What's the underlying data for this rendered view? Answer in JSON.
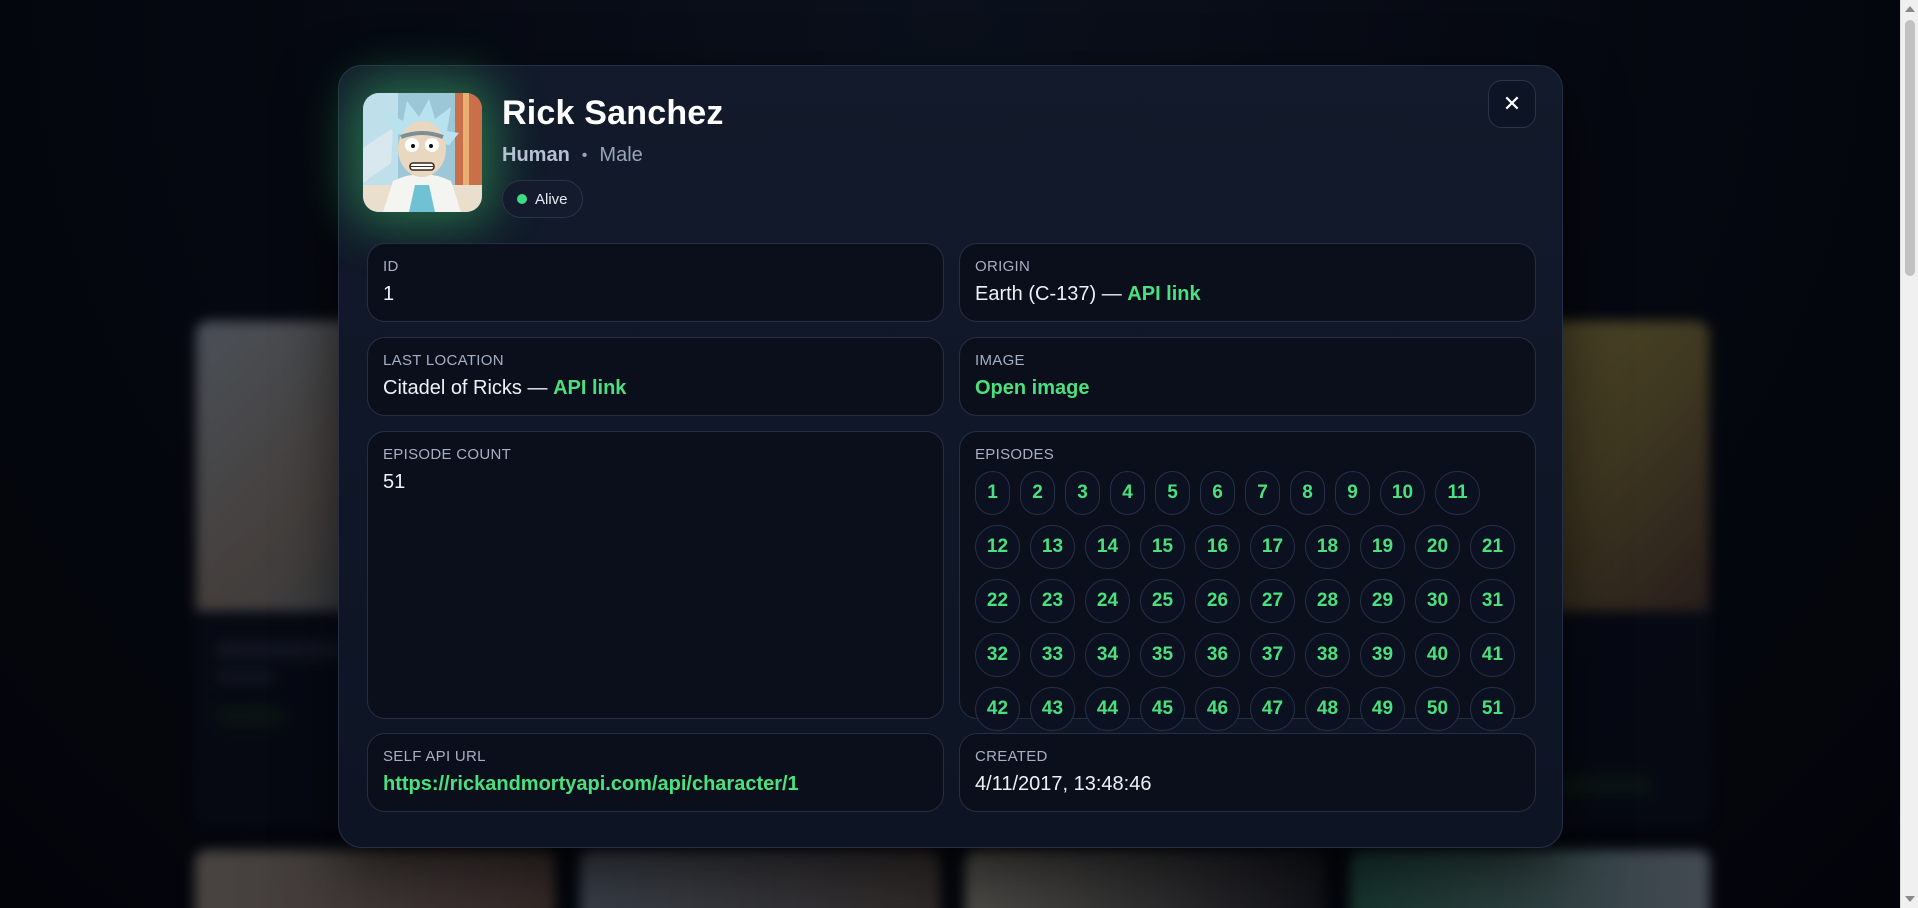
{
  "modal": {
    "name": "Rick Sanchez",
    "species": "Human",
    "separator": "•",
    "gender": "Male",
    "status": "Alive",
    "close_label": "✕"
  },
  "fields": {
    "id": {
      "label": "ID",
      "value": "1"
    },
    "origin": {
      "label": "ORIGIN",
      "value": "Earth (C-137)",
      "separator": "—",
      "link": "API link"
    },
    "last_location": {
      "label": "LAST LOCATION",
      "value": "Citadel of Ricks",
      "separator": "—",
      "link": "API link"
    },
    "image": {
      "label": "IMAGE",
      "link": "Open image"
    },
    "episode_count": {
      "label": "EPISODE COUNT",
      "value": "51"
    },
    "episodes": {
      "label": "EPISODES",
      "rows": [
        [
          "1",
          "2",
          "3",
          "4",
          "5",
          "6",
          "7",
          "8",
          "9",
          "10",
          "11"
        ],
        [
          "12",
          "13",
          "14",
          "15",
          "16",
          "17",
          "18",
          "19",
          "20",
          "21"
        ],
        [
          "22",
          "23",
          "24",
          "25",
          "26",
          "27",
          "28",
          "29",
          "30",
          "31"
        ],
        [
          "32",
          "33",
          "34",
          "35",
          "36",
          "37",
          "38",
          "39",
          "40",
          "41"
        ],
        [
          "42",
          "43",
          "44",
          "45",
          "46",
          "47",
          "48",
          "49",
          "50",
          "51"
        ]
      ]
    },
    "self_api_url": {
      "label": "SELF API URL",
      "link": "https://rickandmortyapi.com/api/character/1"
    },
    "created": {
      "label": "CREATED",
      "value": "4/11/2017, 13:48:46"
    }
  },
  "colors": {
    "accent": "#4ae07e",
    "status_alive": "#3ddc84",
    "modal_bg": "#121a2b",
    "page_bg": "#05080f"
  },
  "icons": {
    "close": "close-icon",
    "status": "status-dot-icon"
  }
}
